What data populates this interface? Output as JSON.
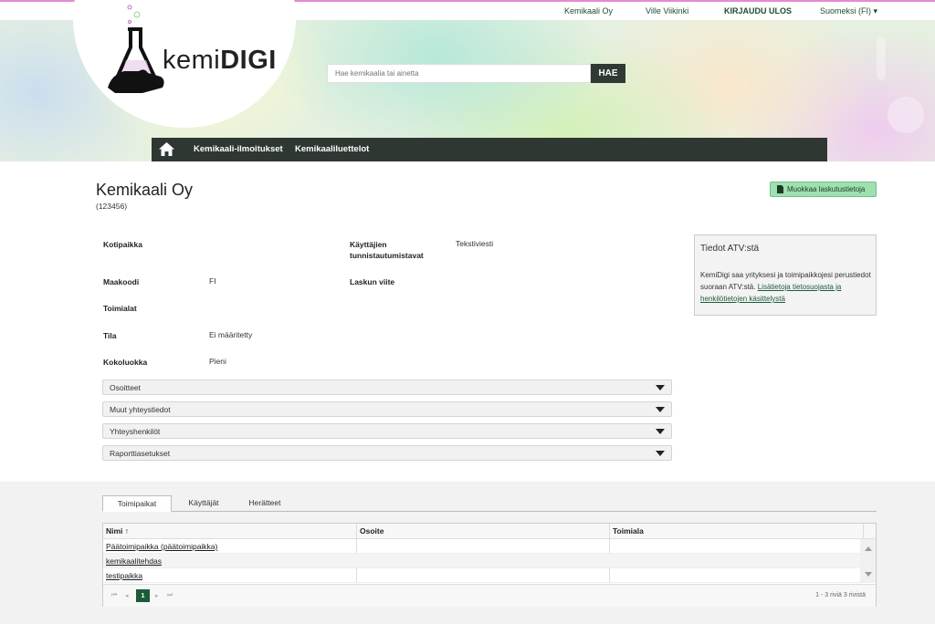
{
  "topbar": {
    "company": "Kemikaali Oy",
    "user": "Ville Viikinki",
    "logout": "KIRJAUDU ULOS",
    "language": "Suomeksi (FI)"
  },
  "logo": {
    "prefix": "kemi",
    "suffix": "DIGI"
  },
  "search": {
    "placeholder": "Hae kemikaalia tai ainetta",
    "button": "HAE"
  },
  "nav": {
    "items": [
      "Kemikaali-ilmoitukset",
      "Kemikaaliluettelot"
    ]
  },
  "company": {
    "title": "Kemikaali Oy",
    "id": "(123456)",
    "edit_button": "Muokkaa laskutustietoja"
  },
  "details": {
    "kotipaikka_label": "Kotipaikka",
    "maakoodi_label": "Maakoodi",
    "maakoodi_value": "FI",
    "toimialat_label": "Toimialat",
    "tila_label": "Tila",
    "tila_value": "Ei määritetty",
    "kokoluokka_label": "Kokoluokka",
    "kokoluokka_value": "Pieni",
    "tunnistautuminen_label_1": "Käyttäjien",
    "tunnistautuminen_label_2": "tunnistautumistavat",
    "tunnistautuminen_value": "Tekstiviesti",
    "laskun_viite_label": "Laskun viite"
  },
  "atv": {
    "title": "Tiedot ATV:stä",
    "text": "KemiDigi saa yrityksesi ja toimipaikkojesi perustiedot suoraan ATV:stä.",
    "link": "Lisätietoja tietosuojasta ja henkilötietojen käsittelystä"
  },
  "accordions": [
    "Osoitteet",
    "Muut yhteystiedot",
    "Yhteyshenkilöt",
    "Raporttiasetukset"
  ],
  "tabs": [
    "Toimipaikat",
    "Käyttäjät",
    "Herätteet"
  ],
  "table": {
    "columns": [
      "Nimi ↑",
      "Osoite",
      "Toimiala"
    ],
    "rows": [
      "Päätoimipaikka (päätoimipaikka)",
      "kemikaalitehdas",
      "testipaikka"
    ],
    "page": "1",
    "info": "1 - 3 riviä 3 rivistä"
  },
  "colors": {
    "nav": "#2f3733",
    "accent": "#1e5a37",
    "edit_button": "#9fe0b0"
  }
}
